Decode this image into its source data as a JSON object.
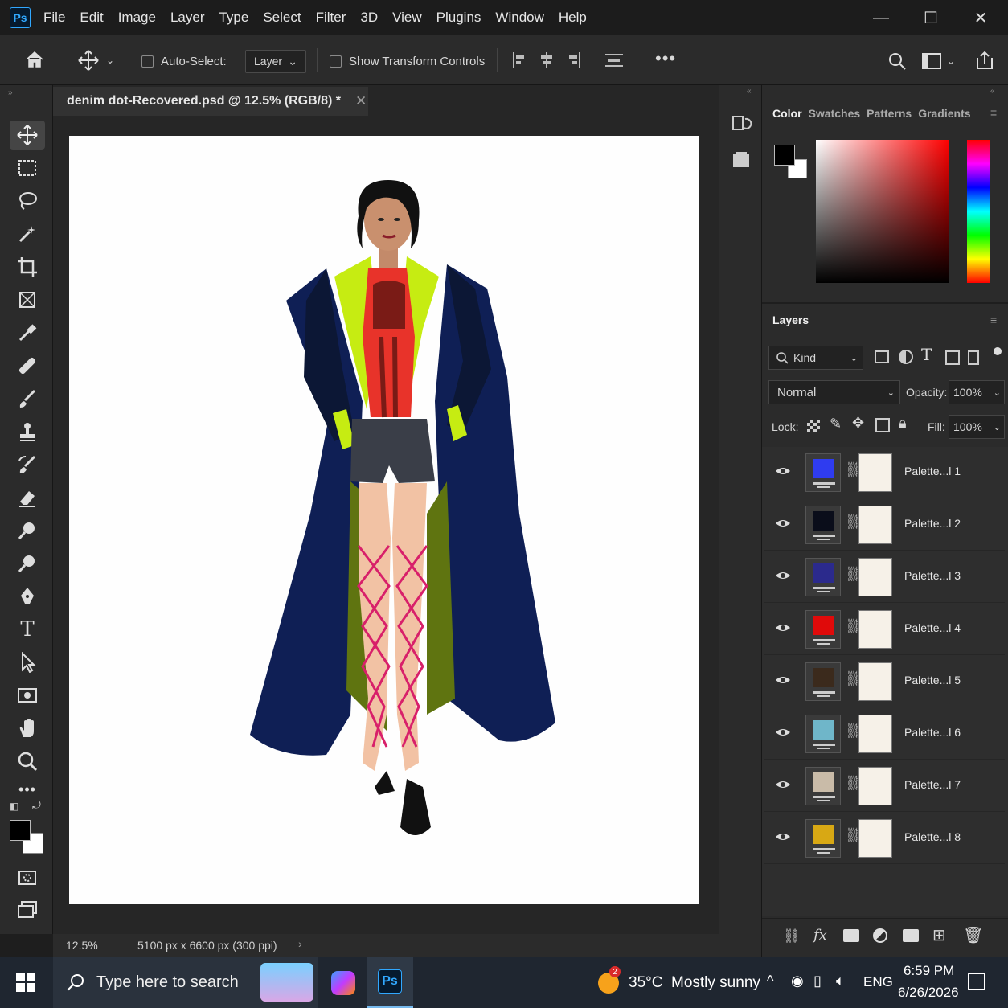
{
  "app": {
    "logo": "Ps"
  },
  "menu": [
    "File",
    "Edit",
    "Image",
    "Layer",
    "Type",
    "Select",
    "Filter",
    "3D",
    "View",
    "Plugins",
    "Window",
    "Help"
  ],
  "window_controls": {
    "minimize": "—",
    "maximize": "☐",
    "close": "✕"
  },
  "options": {
    "auto_select_label": "Auto-Select:",
    "layer_dropdown": "Layer",
    "show_transform_label": "Show Transform Controls",
    "more": "•••"
  },
  "document": {
    "tab_title": "denim dot-Recovered.psd @ 12.5% (RGB/8) *",
    "close": "✕",
    "zoom": "12.5%",
    "dimensions": "5100 px x 6600 px (300 ppi)"
  },
  "color_panel": {
    "tabs": [
      "Color",
      "Swatches",
      "Patterns",
      "Gradients"
    ],
    "foreground": "#000000",
    "background": "#ffffff",
    "hue": "#ff0000"
  },
  "layers_panel": {
    "title": "Layers",
    "filter_kind": "Kind",
    "blend_mode": "Normal",
    "opacity_label": "Opacity:",
    "opacity_value": "100%",
    "lock_label": "Lock:",
    "fill_label": "Fill:",
    "fill_value": "100%",
    "layers": [
      {
        "name": "Palette...l 1",
        "color": "#2f3cf0"
      },
      {
        "name": "Palette...l 2",
        "color": "#0a0d1a"
      },
      {
        "name": "Palette...l 3",
        "color": "#2b2a8c"
      },
      {
        "name": "Palette...l 4",
        "color": "#e00a0a"
      },
      {
        "name": "Palette...l 5",
        "color": "#3b2a1c"
      },
      {
        "name": "Palette...l 6",
        "color": "#6fb6c9"
      },
      {
        "name": "Palette...l 7",
        "color": "#c9bba8"
      },
      {
        "name": "Palette...l 8",
        "color": "#d8a814"
      }
    ]
  },
  "taskbar": {
    "search_placeholder": "Type here to search",
    "ps_label": "Ps",
    "weather_badge": "2",
    "weather": "35°C  Mostly sunny",
    "language": "ENG",
    "time": "6:59 PM",
    "date": "6/26/2026"
  }
}
